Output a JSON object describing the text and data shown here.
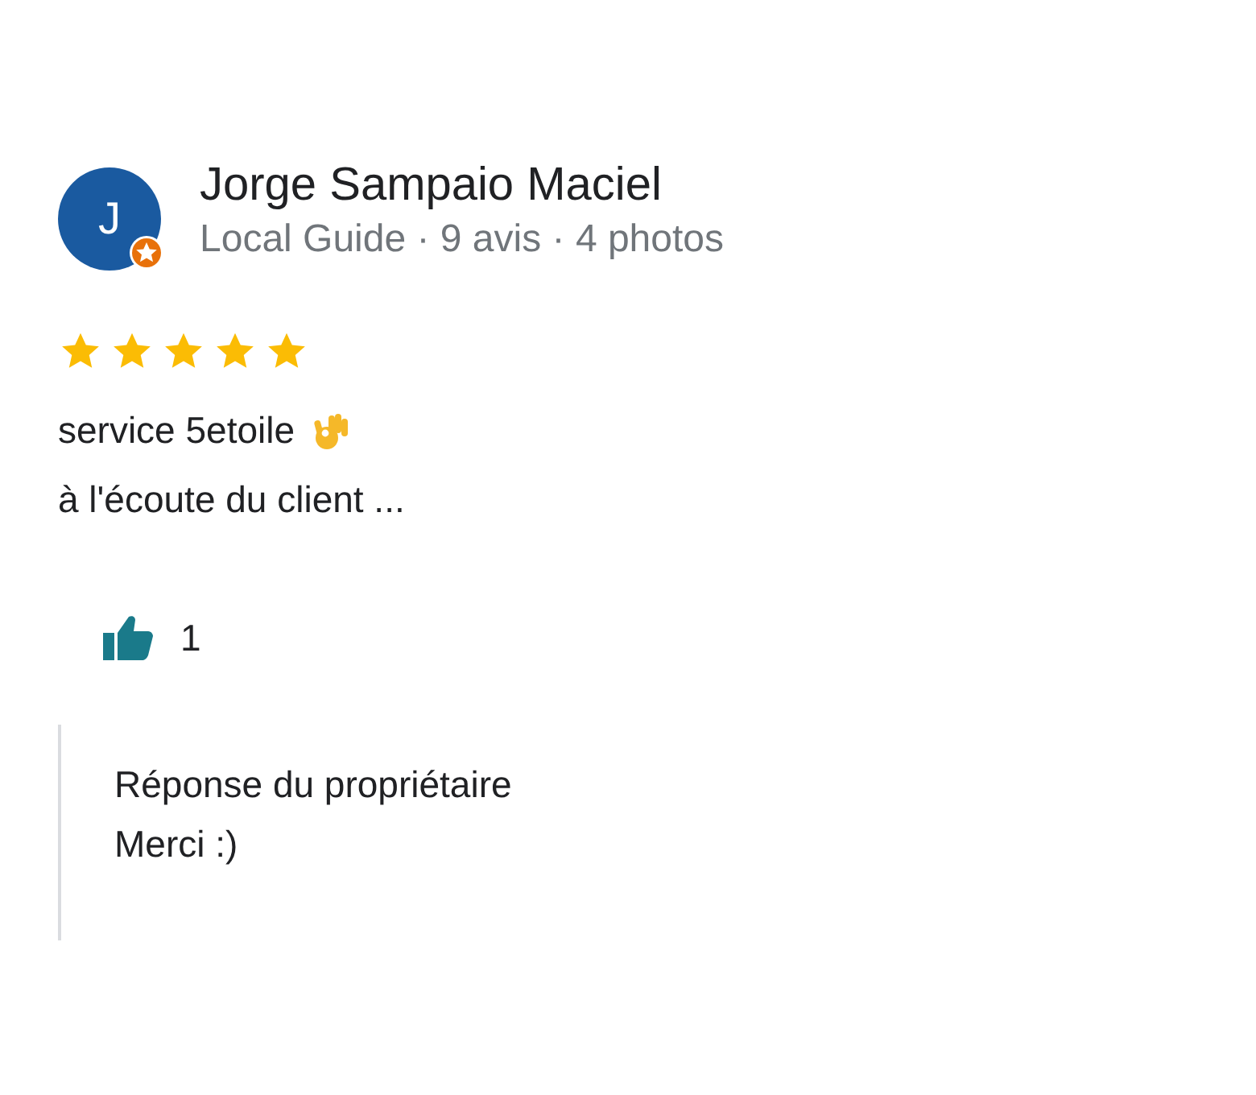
{
  "review": {
    "avatar": {
      "initial": "J",
      "local_guide_badge": true
    },
    "author": "Jorge Sampaio Maciel",
    "meta": "Local Guide · 9 avis · 4 photos",
    "stars": 5,
    "text_lines": [
      {
        "text": "service 5etoile",
        "hand_icon": true
      },
      {
        "text": "à l'écoute du client ..."
      }
    ],
    "likes": {
      "count": "1",
      "liked": true
    },
    "owner_reply": {
      "title": "Réponse du propriétaire",
      "text": "Merci :)"
    }
  }
}
